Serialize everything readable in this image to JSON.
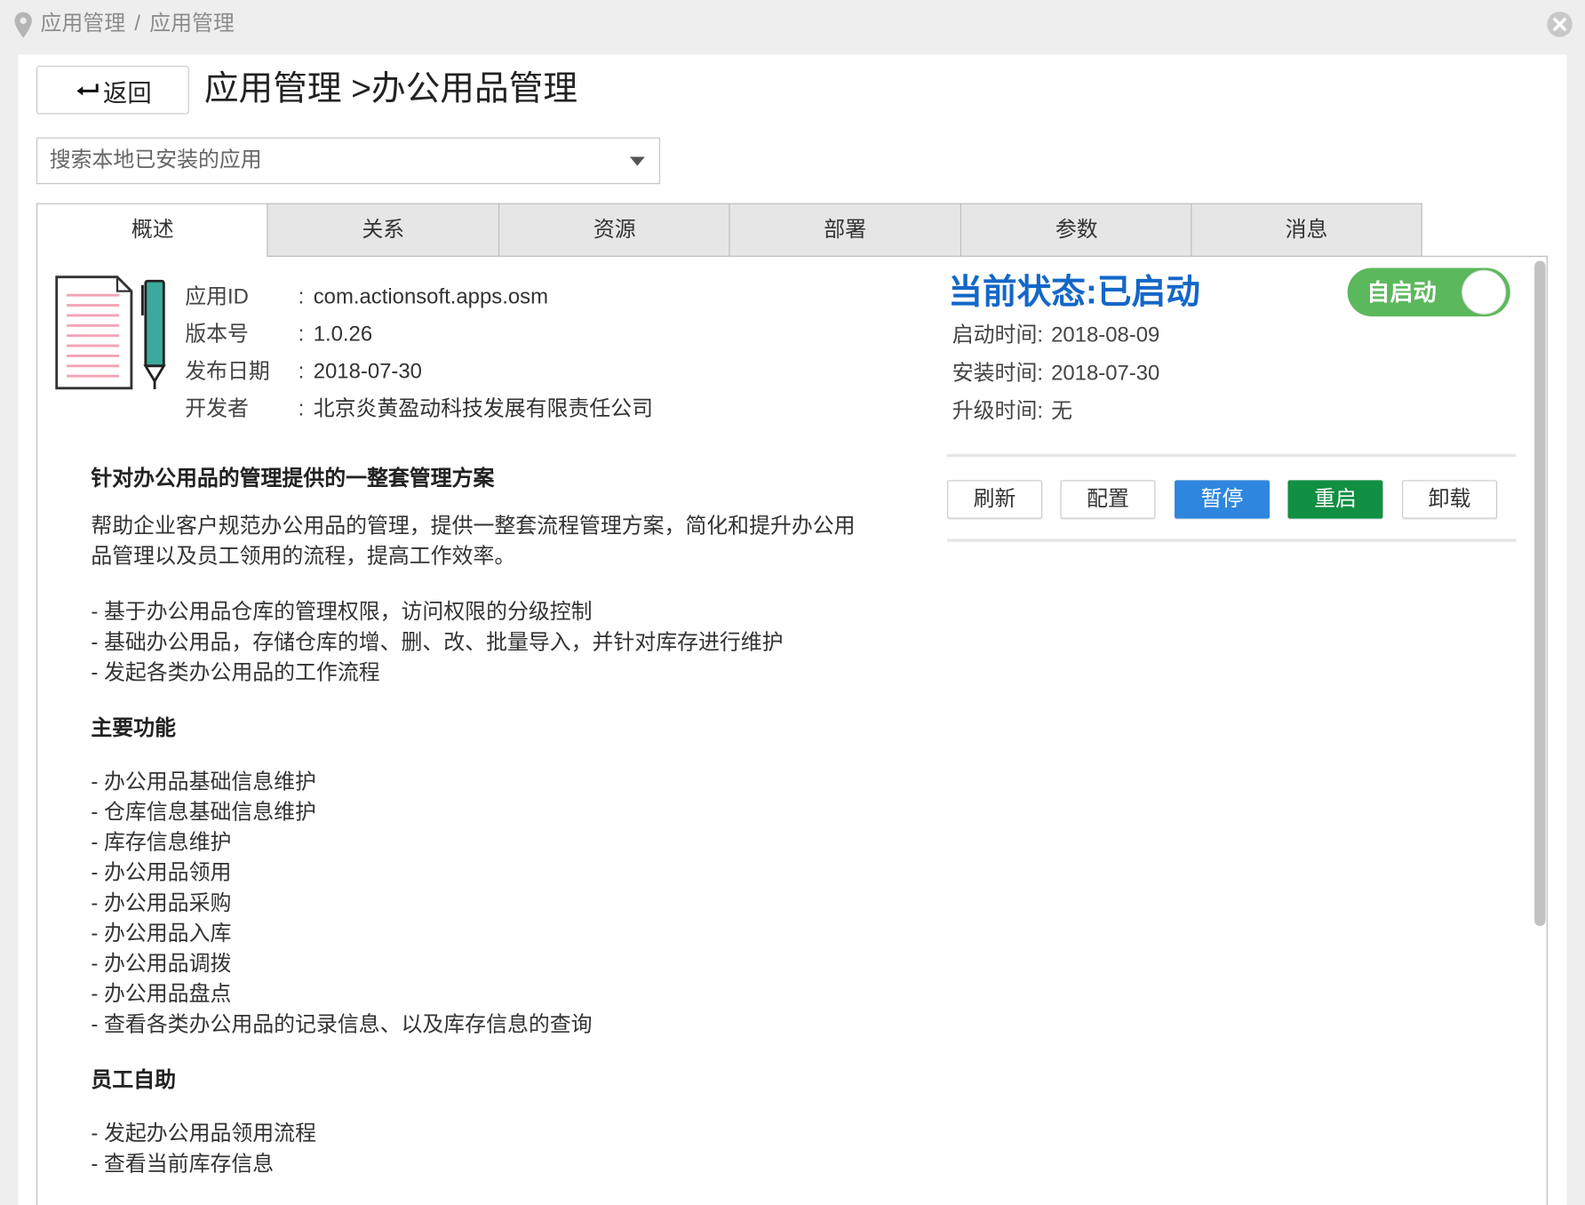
{
  "breadcrumb": {
    "items": [
      "应用管理",
      "应用管理"
    ],
    "separator": "/"
  },
  "header": {
    "back_label": "返回",
    "title": "应用管理 >办公用品管理"
  },
  "search": {
    "placeholder": "搜索本地已安装的应用"
  },
  "tabs": [
    {
      "label": "概述",
      "active": true
    },
    {
      "label": "关系",
      "active": false
    },
    {
      "label": "资源",
      "active": false
    },
    {
      "label": "部署",
      "active": false
    },
    {
      "label": "参数",
      "active": false
    },
    {
      "label": "消息",
      "active": false
    }
  ],
  "app_info": {
    "separator": ":",
    "fields": [
      {
        "label": "应用ID",
        "value": "com.actionsoft.apps.osm"
      },
      {
        "label": "版本号",
        "value": "1.0.26"
      },
      {
        "label": "发布日期",
        "value": "2018-07-30"
      },
      {
        "label": "开发者",
        "value": "北京炎黄盈动科技发展有限责任公司"
      }
    ]
  },
  "status": {
    "title": "当前状态:已启动",
    "toggle_label": "自启动",
    "toggle_on": true,
    "times": [
      {
        "label": "启动时间:",
        "value": "2018-08-09"
      },
      {
        "label": "安装时间:",
        "value": "2018-07-30"
      },
      {
        "label": "升级时间:",
        "value": "无"
      }
    ]
  },
  "actions": [
    {
      "label": "刷新"
    },
    {
      "label": "配置"
    },
    {
      "label": "暂停"
    },
    {
      "label": "重启"
    },
    {
      "label": "卸载"
    }
  ],
  "description": {
    "heading": "针对办公用品的管理提供的一整套管理方案",
    "intro_lines": [
      "帮助企业客户规范办公用品的管理，提供一整套流程管理方案，简化和提升办公用",
      "品管理以及员工领用的流程，提高工作效率。"
    ],
    "points": [
      "- 基于办公用品仓库的管理权限，访问权限的分级控制",
      "- 基础办公用品，存储仓库的增、删、改、批量导入，并针对库存进行维护",
      "- 发起各类办公用品的工作流程"
    ],
    "sections": [
      {
        "title": "主要功能",
        "items": [
          "- 办公用品基础信息维护",
          "- 仓库信息基础信息维护",
          "- 库存信息维护",
          "- 办公用品领用",
          "- 办公用品采购",
          "- 办公用品入库",
          "- 办公用品调拨",
          "- 办公用品盘点",
          "- 查看各类办公用品的记录信息、以及库存信息的查询"
        ]
      },
      {
        "title": "员工自助",
        "items": [
          "- 发起办公用品领用流程",
          "- 查看当前库存信息"
        ]
      }
    ]
  },
  "icons": {
    "breadcrumb": "location-pin-icon",
    "close": "close-circle-icon",
    "back": "back-arrow-icon",
    "dropdown": "chevron-down-icon",
    "app": "document-pen-icon"
  },
  "colors": {
    "status_blue": "#1367c8",
    "pause_blue": "#2f86df",
    "restart_green": "#118f43",
    "toggle_green": "#5cb85c"
  }
}
